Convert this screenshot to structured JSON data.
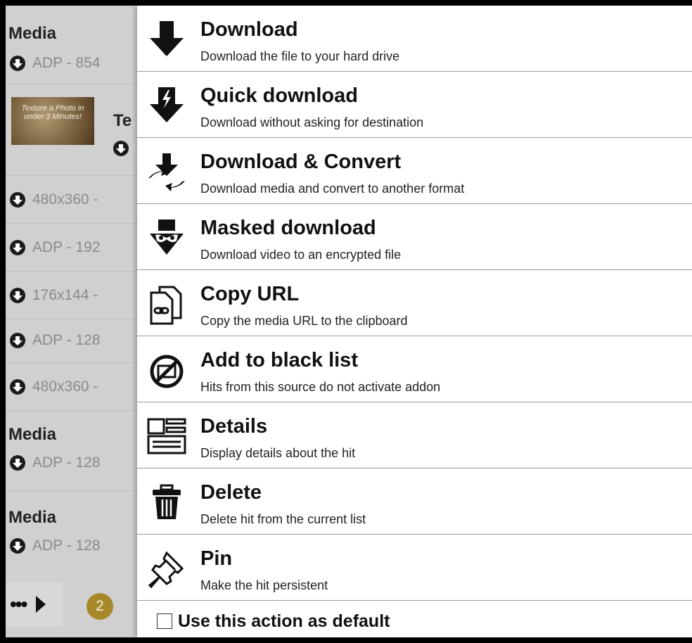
{
  "hit_list": {
    "groups": [
      {
        "title": "Media",
        "entry": "ADP - 854"
      },
      {
        "title": "Media",
        "entry": "ADP - 128"
      },
      {
        "title": "Media",
        "entry": "ADP - 128"
      }
    ],
    "thumbnail": {
      "caption": "Texture a Photo in under 3 Minutes!",
      "title": "Te"
    },
    "entries": [
      "480x360 -",
      "ADP - 192",
      "176x144 -",
      "ADP - 128",
      "480x360 -"
    ],
    "footer": {
      "more": "•••",
      "count": "2"
    }
  },
  "actions": [
    {
      "label": "Download",
      "description": "Download the file to your hard drive",
      "icon": "download-icon"
    },
    {
      "label": "Quick download",
      "description": "Download without asking for destination",
      "icon": "quick-download-icon"
    },
    {
      "label": "Download & Convert",
      "description": "Download media and convert to another format",
      "icon": "download-convert-icon"
    },
    {
      "label": "Masked download",
      "description": "Download video to an encrypted file",
      "icon": "masked-download-icon"
    },
    {
      "label": "Copy URL",
      "description": "Copy the media URL to the clipboard",
      "icon": "copy-url-icon"
    },
    {
      "label": "Add to black list",
      "description": "Hits from this source do not activate addon",
      "icon": "blacklist-icon"
    },
    {
      "label": "Details",
      "description": "Display details about the hit",
      "icon": "details-icon"
    },
    {
      "label": "Delete",
      "description": "Delete hit from the current list",
      "icon": "trash-icon"
    },
    {
      "label": "Pin",
      "description": "Make the hit persistent",
      "icon": "pin-icon"
    }
  ],
  "default_option": {
    "label": "Use this action as default",
    "checked": false
  },
  "colors": {
    "badge": "#a8892a",
    "list_bg": "#d0d0d0",
    "menu_bg": "#ffffff"
  }
}
